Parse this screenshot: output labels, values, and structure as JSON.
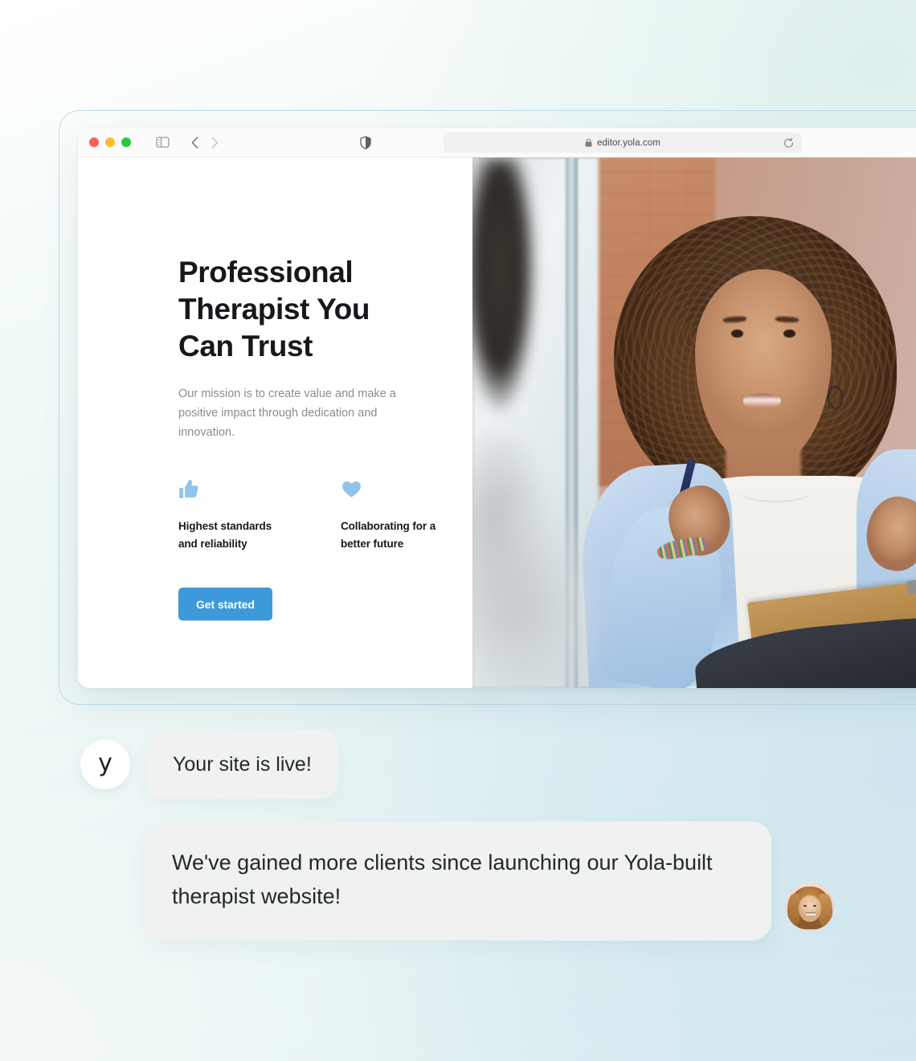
{
  "browser": {
    "traffic_lights": [
      "close",
      "minimize",
      "maximize"
    ],
    "sidebar_toggle_name": "sidebar-toggle-icon",
    "back_label": "Back",
    "forward_label": "Forward",
    "shield_label": "Privacy report",
    "lock_label": "Secure connection",
    "url": "editor.yola.com",
    "reload_label": "Reload"
  },
  "site": {
    "hero": {
      "title": "Professional Therapist You Can Trust",
      "subtitle": "Our mission is to create value and make a positive impact through dedication and innovation.",
      "cta_label": "Get started",
      "features": [
        {
          "icon": "thumbs-up-icon",
          "label": "Highest standards and reliability"
        },
        {
          "icon": "heart-icon",
          "label": "Collaborating for a better future"
        }
      ],
      "photo_alt": "Therapist with clipboard talking to a client"
    }
  },
  "chat": {
    "brand_glyph": "y",
    "brand_name": "Yola",
    "messages": [
      {
        "from": "yola",
        "text": "Your site is live!"
      },
      {
        "from": "client",
        "text": "We've gained more clients since launching our Yola-built therapist website!"
      }
    ],
    "client_avatar_alt": "Smiling woman with long auburn hair"
  },
  "colors": {
    "cta_blue": "#3d9ada",
    "feature_icon_blue": "#8fc5ec",
    "bubble_gray": "#f0f1f1",
    "heading_dark": "#17181c",
    "body_gray": "#8a8d92",
    "frame_border": "#bcdbe8",
    "bg_mint": "#e5f3f1",
    "bg_blue": "#d3e9ef"
  }
}
